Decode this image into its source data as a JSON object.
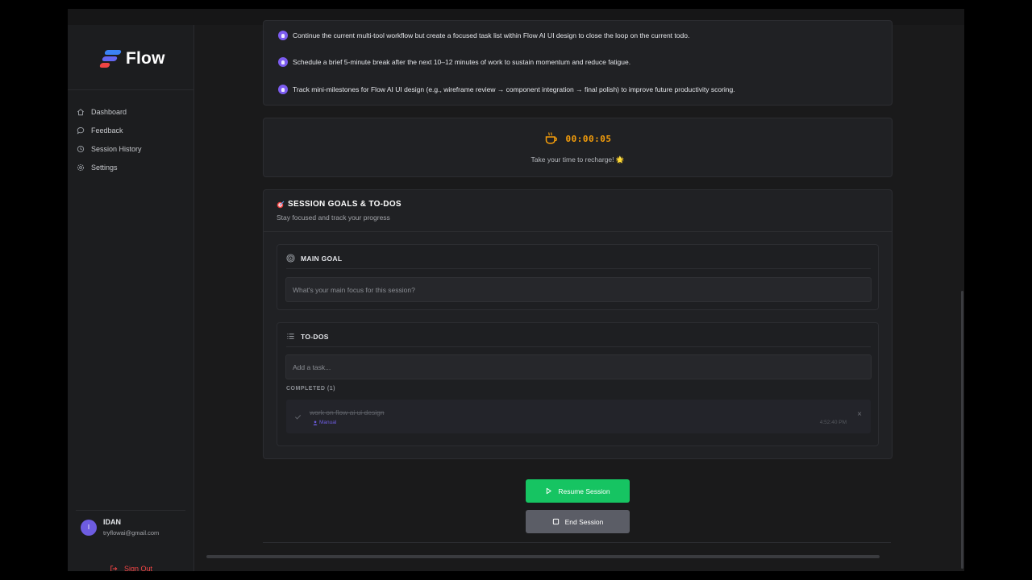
{
  "app": {
    "name": "Flow"
  },
  "sidebar": {
    "items": [
      {
        "label": "Dashboard",
        "icon": "home-icon"
      },
      {
        "label": "Feedback",
        "icon": "chat-bubble-icon"
      },
      {
        "label": "Session History",
        "icon": "history-icon"
      },
      {
        "label": "Settings",
        "icon": "gear-icon"
      }
    ]
  },
  "user": {
    "initial": "I",
    "name": "IDAN",
    "email": "tryflowai@gmail.com",
    "sign_out": "Sign Out"
  },
  "suggestions": [
    "Continue the current multi-tool workflow but create a focused task list within Flow AI UI design to close the loop on the current todo.",
    "Schedule a brief 5-minute break after the next 10–12 minutes of work to sustain momentum and reduce fatigue.",
    "Track mini-milestones for Flow AI UI design (e.g., wireframe review → component integration → final polish) to improve future productivity scoring."
  ],
  "break_timer": {
    "time": "00:00:05",
    "message": "Take your time to recharge! 🌟"
  },
  "goals": {
    "title": "SESSION GOALS & TO-DOS",
    "subtitle": "Stay focused and track your progress",
    "main_goal": {
      "label": "MAIN GOAL",
      "placeholder": "What's your main focus for this session?"
    },
    "todos": {
      "label": "TO-DOS",
      "placeholder": "Add a task...",
      "completed_label": "COMPLETED (1)",
      "completed": [
        {
          "text": "work on flow ai ui design",
          "tag": "Manual",
          "time": "4:52:40 PM"
        }
      ]
    }
  },
  "actions": {
    "resume": "Resume Session",
    "end": "End Session"
  },
  "colors": {
    "accent_purple": "#7c5cf0",
    "resume_green": "#16c462",
    "timer_amber": "#f59e0b",
    "signout_red": "#ef4444"
  }
}
